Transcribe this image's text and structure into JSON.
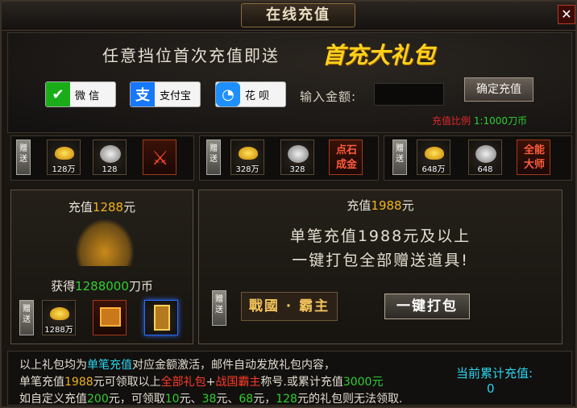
{
  "window": {
    "title": "在线充值",
    "close_label": "✕"
  },
  "promo": {
    "headline": "任意挡位首次充值即送",
    "gift": "首充大礼包"
  },
  "payment": [
    {
      "label": "微 信",
      "icon": "wechat-icon",
      "color": "#1aad19"
    },
    {
      "label": "支付宝",
      "icon": "alipay-icon",
      "color": "#1677ff"
    },
    {
      "label": "花 呗",
      "icon": "huabei-icon",
      "color": "#1e8fff"
    }
  ],
  "amount": {
    "label": "输入金额:",
    "value": ""
  },
  "confirm_label": "确定充值",
  "ratio": {
    "label": "充值比例",
    "value": "1:1000刀币"
  },
  "strips": [
    {
      "tag": "赠送",
      "ingot": "128万",
      "silver": "128",
      "third": "",
      "third_icon": "sword-icon"
    },
    {
      "tag": "赠送",
      "ingot": "328万",
      "silver": "328",
      "third": "点石成金",
      "third_icon": "skill-book-icon"
    },
    {
      "tag": "赠送",
      "ingot": "648万",
      "silver": "648",
      "third": "全能大师",
      "third_icon": "skill-book-icon"
    }
  ],
  "panel_1288": {
    "title_prefix": "充值",
    "title_amount": "1288",
    "title_suffix": "元",
    "obtain_prefix": "获得",
    "obtain_amount": "1288000",
    "obtain_suffix": "刀币",
    "tag": "赠送",
    "ingot": "1288万"
  },
  "panel_1988": {
    "title_prefix": "充值",
    "title_amount": "1988",
    "title_suffix": "元",
    "desc_line1": "单笔充值1988元及以上",
    "desc_line2": "一键打包全部赠送道具!",
    "tag": "赠送",
    "title_badge": "戰國 · 霸主",
    "pack_label": "一键打包"
  },
  "notes": {
    "l1a": "以上礼包均为",
    "l1b": "单笔充值",
    "l1c": "对应金额激活，邮件自动发放礼包内容，",
    "l2a": "单笔充值",
    "l2b": "1988",
    "l2c": "元可领取以上",
    "l2d": "全部礼包",
    "l2e": "+",
    "l2f": "战国霸主",
    "l2g": "称号.或累计充值",
    "l2h": "3000元",
    "l3a": "如自定义充值",
    "l3b": "200",
    "l3c": "元，可领取",
    "l3d": "10",
    "l3e": "元、",
    "l3f": "38",
    "l3g": "元、",
    "l3h": "68",
    "l3i": "元，",
    "l3j": "128",
    "l3k": "元的礼包则无法领取."
  },
  "accumulated": {
    "label": "当前累计充值:",
    "value": "0"
  }
}
